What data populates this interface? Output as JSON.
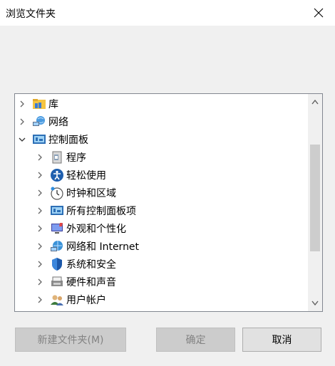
{
  "window": {
    "title": "浏览文件夹",
    "close_icon": "close-icon"
  },
  "tree": {
    "items": [
      {
        "label": "库",
        "icon": "library-icon",
        "expanded": false,
        "level": 0
      },
      {
        "label": "网络",
        "icon": "network-icon",
        "expanded": false,
        "level": 0
      },
      {
        "label": "控制面板",
        "icon": "control-panel-icon",
        "expanded": true,
        "level": 0
      },
      {
        "label": "程序",
        "icon": "programs-icon",
        "expanded": false,
        "level": 1
      },
      {
        "label": "轻松使用",
        "icon": "ease-of-access-icon",
        "expanded": false,
        "level": 1
      },
      {
        "label": "时钟和区域",
        "icon": "clock-region-icon",
        "expanded": false,
        "level": 1
      },
      {
        "label": "所有控制面板项",
        "icon": "all-control-panel-items-icon",
        "expanded": false,
        "level": 1
      },
      {
        "label": "外观和个性化",
        "icon": "appearance-icon",
        "expanded": false,
        "level": 1
      },
      {
        "label": "网络和 Internet",
        "icon": "network-internet-icon",
        "expanded": false,
        "level": 1
      },
      {
        "label": "系统和安全",
        "icon": "system-security-icon",
        "expanded": false,
        "level": 1
      },
      {
        "label": "硬件和声音",
        "icon": "hardware-sound-icon",
        "expanded": false,
        "level": 1
      },
      {
        "label": "用户帐户",
        "icon": "user-accounts-icon",
        "expanded": false,
        "level": 1
      }
    ]
  },
  "buttons": {
    "new_folder": "新建文件夹(M)",
    "ok": "确定",
    "cancel": "取消"
  }
}
